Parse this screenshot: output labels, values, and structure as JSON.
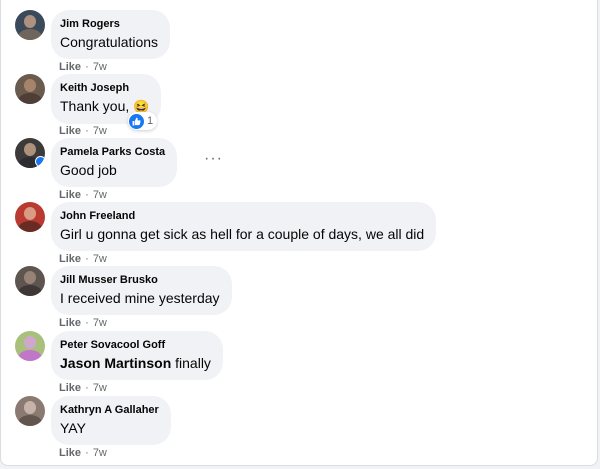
{
  "comments": [
    {
      "author": "Jim Rogers",
      "text": "Congratulations",
      "action": "Like",
      "time": "7w",
      "avatar_colors": [
        "#3b4a5a",
        "#7a6a5e"
      ]
    },
    {
      "author": "Keith Joseph",
      "text": "Thank you,",
      "emoji": "😆",
      "action": "Like",
      "time": "7w",
      "avatar_colors": [
        "#6b5a4e",
        "#b58e72"
      ],
      "reaction": {
        "icon": "like-thumb",
        "count": "1"
      }
    },
    {
      "author": "Pamela Parks Costa",
      "text": "Good job",
      "action": "Like",
      "time": "7w",
      "avatar_colors": [
        "#3d3a3a",
        "#c9a88f"
      ],
      "more_menu": "···"
    },
    {
      "author": "John Freeland",
      "text": "Girl u gonna get sick as hell for a couple of days, we all did",
      "action": "Like",
      "time": "7w",
      "avatar_colors": [
        "#b83a30",
        "#5a2a22"
      ]
    },
    {
      "author": "Jill Musser Brusko",
      "text": "I received mine yesterday",
      "action": "Like",
      "time": "7w",
      "avatar_colors": [
        "#5e5450",
        "#a58f80"
      ]
    },
    {
      "author": "Peter Sovacool Goff",
      "mention": "Jason Martinson",
      "text": " finally",
      "action": "Like",
      "time": "7w",
      "avatar_colors": [
        "#a9c07c",
        "#c46ad6"
      ]
    },
    {
      "author": "Kathryn A Gallaher",
      "text": "YAY",
      "action": "Like",
      "time": "7w",
      "avatar_colors": [
        "#8a7a72",
        "#d6c2b6"
      ]
    }
  ],
  "separator": "·",
  "colors": {
    "bubble": "#f0f2f5",
    "meta": "#65676b",
    "like_blue": "#1877f2"
  }
}
